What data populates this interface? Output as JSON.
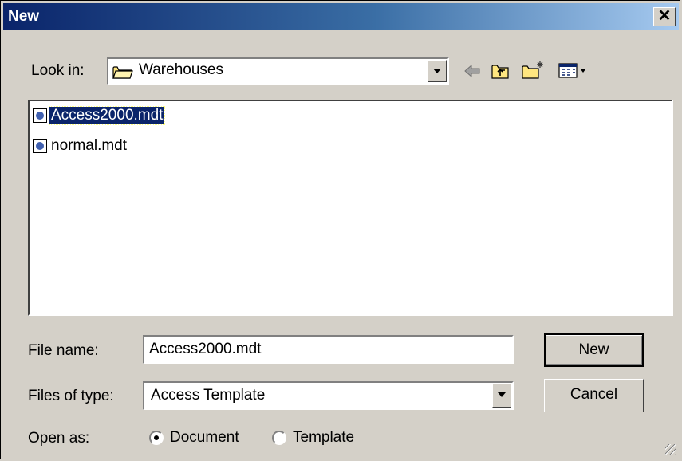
{
  "window": {
    "title": "New"
  },
  "look_in": {
    "label": "Look in:",
    "value": "Warehouses"
  },
  "files": [
    {
      "name": "Access2000.mdt",
      "selected": true
    },
    {
      "name": "normal.mdt",
      "selected": false
    }
  ],
  "file_name": {
    "label": "File name:",
    "value": "Access2000.mdt"
  },
  "files_of_type": {
    "label": "Files of type:",
    "value": "Access Template"
  },
  "open_as": {
    "label": "Open as:",
    "options": [
      "Document",
      "Template"
    ],
    "selected": "Document"
  },
  "buttons": {
    "new_label": "New",
    "cancel_label": "Cancel"
  },
  "icons": [
    "close-icon",
    "folder-icon",
    "back-arrow-icon",
    "up-folder-icon",
    "new-folder-icon",
    "view-menu-icon",
    "file-icon",
    "size-grip-icon"
  ],
  "colors": {
    "title_start": "#0a246a",
    "title_end": "#a6caf0",
    "face": "#d4d0c8",
    "selection": "#0a246a"
  }
}
